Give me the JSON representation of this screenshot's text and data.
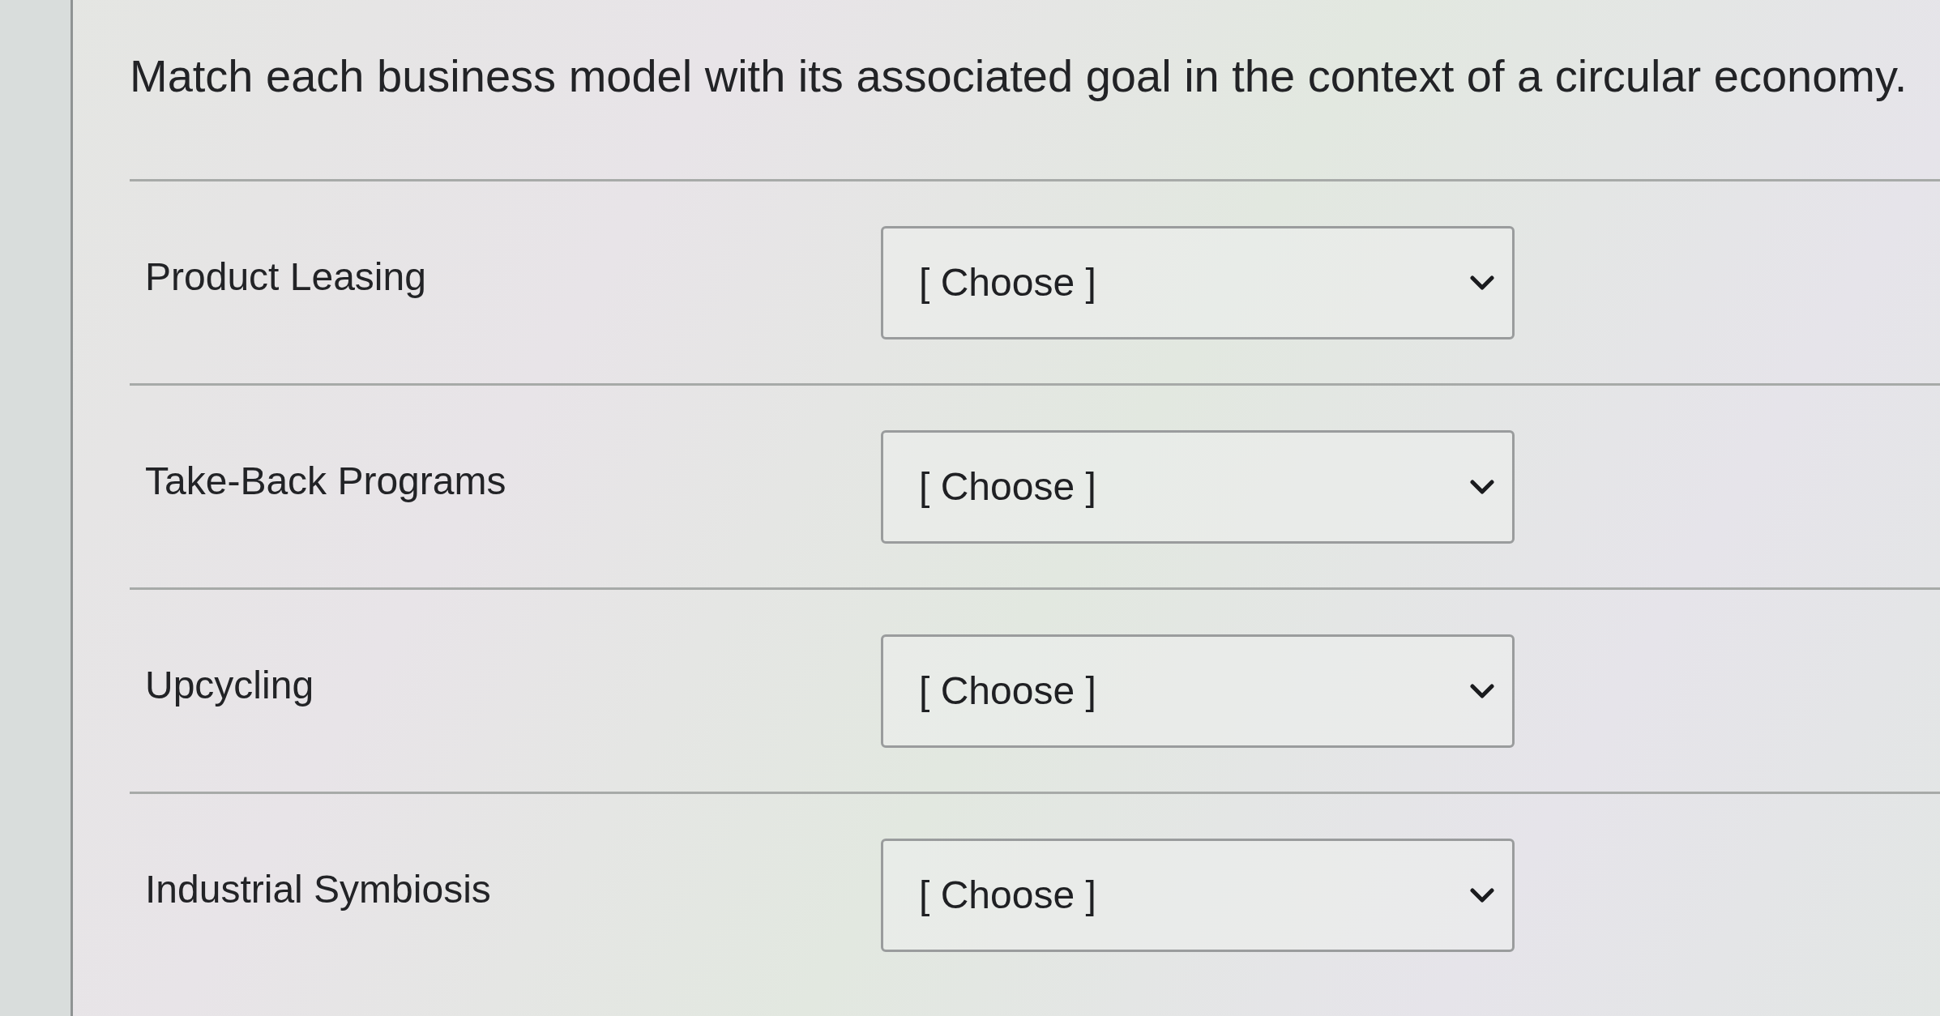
{
  "question": {
    "text": "Match each business model with its associated goal in the context of a circular economy."
  },
  "matches": [
    {
      "term": "Product Leasing",
      "selection": "[ Choose ]"
    },
    {
      "term": "Take-Back Programs",
      "selection": "[ Choose ]"
    },
    {
      "term": "Upcycling",
      "selection": "[ Choose ]"
    },
    {
      "term": "Industrial Symbiosis",
      "selection": "[ Choose ]"
    }
  ]
}
